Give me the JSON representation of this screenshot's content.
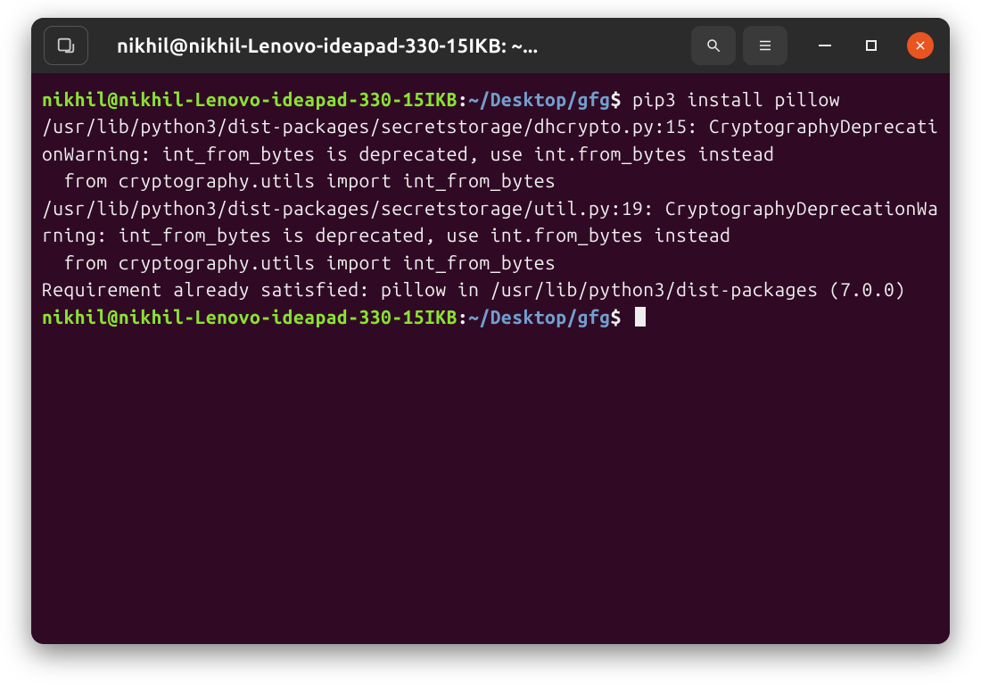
{
  "titlebar": {
    "title": "nikhil@nikhil-Lenovo-ideapad-330-15IKB: ~..."
  },
  "prompt": {
    "user_host": "nikhil@nikhil-Lenovo-ideapad-330-15IKB",
    "colon": ":",
    "path": "~/Desktop/gfg",
    "symbol": "$"
  },
  "command": "pip3 install pillow",
  "output": {
    "warn1_path": "/usr/lib/python3/dist-packages/secretstorage/dhcrypto.py:15: CryptographyDeprecationWarning: int_from_bytes is deprecated, use int.from_bytes instead",
    "warn1_import": "  from cryptography.utils import int_from_bytes",
    "warn2_path": "/usr/lib/python3/dist-packages/secretstorage/util.py:19: CryptographyDeprecationWarning: int_from_bytes is deprecated, use int.from_bytes instead",
    "warn2_import": "  from cryptography.utils import int_from_bytes",
    "satisfied": "Requirement already satisfied: pillow in /usr/lib/python3/dist-packages (7.0.0)"
  }
}
